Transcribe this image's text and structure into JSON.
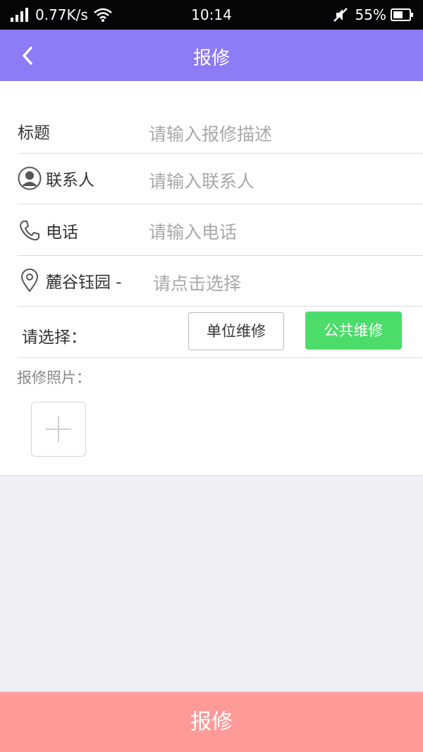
{
  "status_bar": {
    "speed": "0.77K/s",
    "time": "10:14",
    "battery": "55%"
  },
  "nav": {
    "title": "报修",
    "back_icon": "chevron-left-icon"
  },
  "form": {
    "title_row": {
      "label": "标题",
      "placeholder": "请输入报修描述"
    },
    "contact_row": {
      "label": "联系人",
      "placeholder": "请输入联系人",
      "icon": "user-icon"
    },
    "phone_row": {
      "label": "电话",
      "placeholder": "请输入电话",
      "icon": "phone-icon"
    },
    "location_row": {
      "label": "麓谷钰园 -",
      "placeholder": "请点击选择",
      "icon": "location-pin-icon"
    },
    "select_row": {
      "label": "请选择：",
      "option_unit": "单位维修",
      "option_public": "公共维修",
      "selected": "公共维修"
    },
    "photo": {
      "label": "报修照片：",
      "add_icon": "plus-icon"
    }
  },
  "submit": {
    "label": "报修"
  },
  "colors": {
    "nav_bg": "#8e7bf6",
    "submit_bg": "#fe9b99",
    "selected_btn": "#4cdc6a"
  }
}
